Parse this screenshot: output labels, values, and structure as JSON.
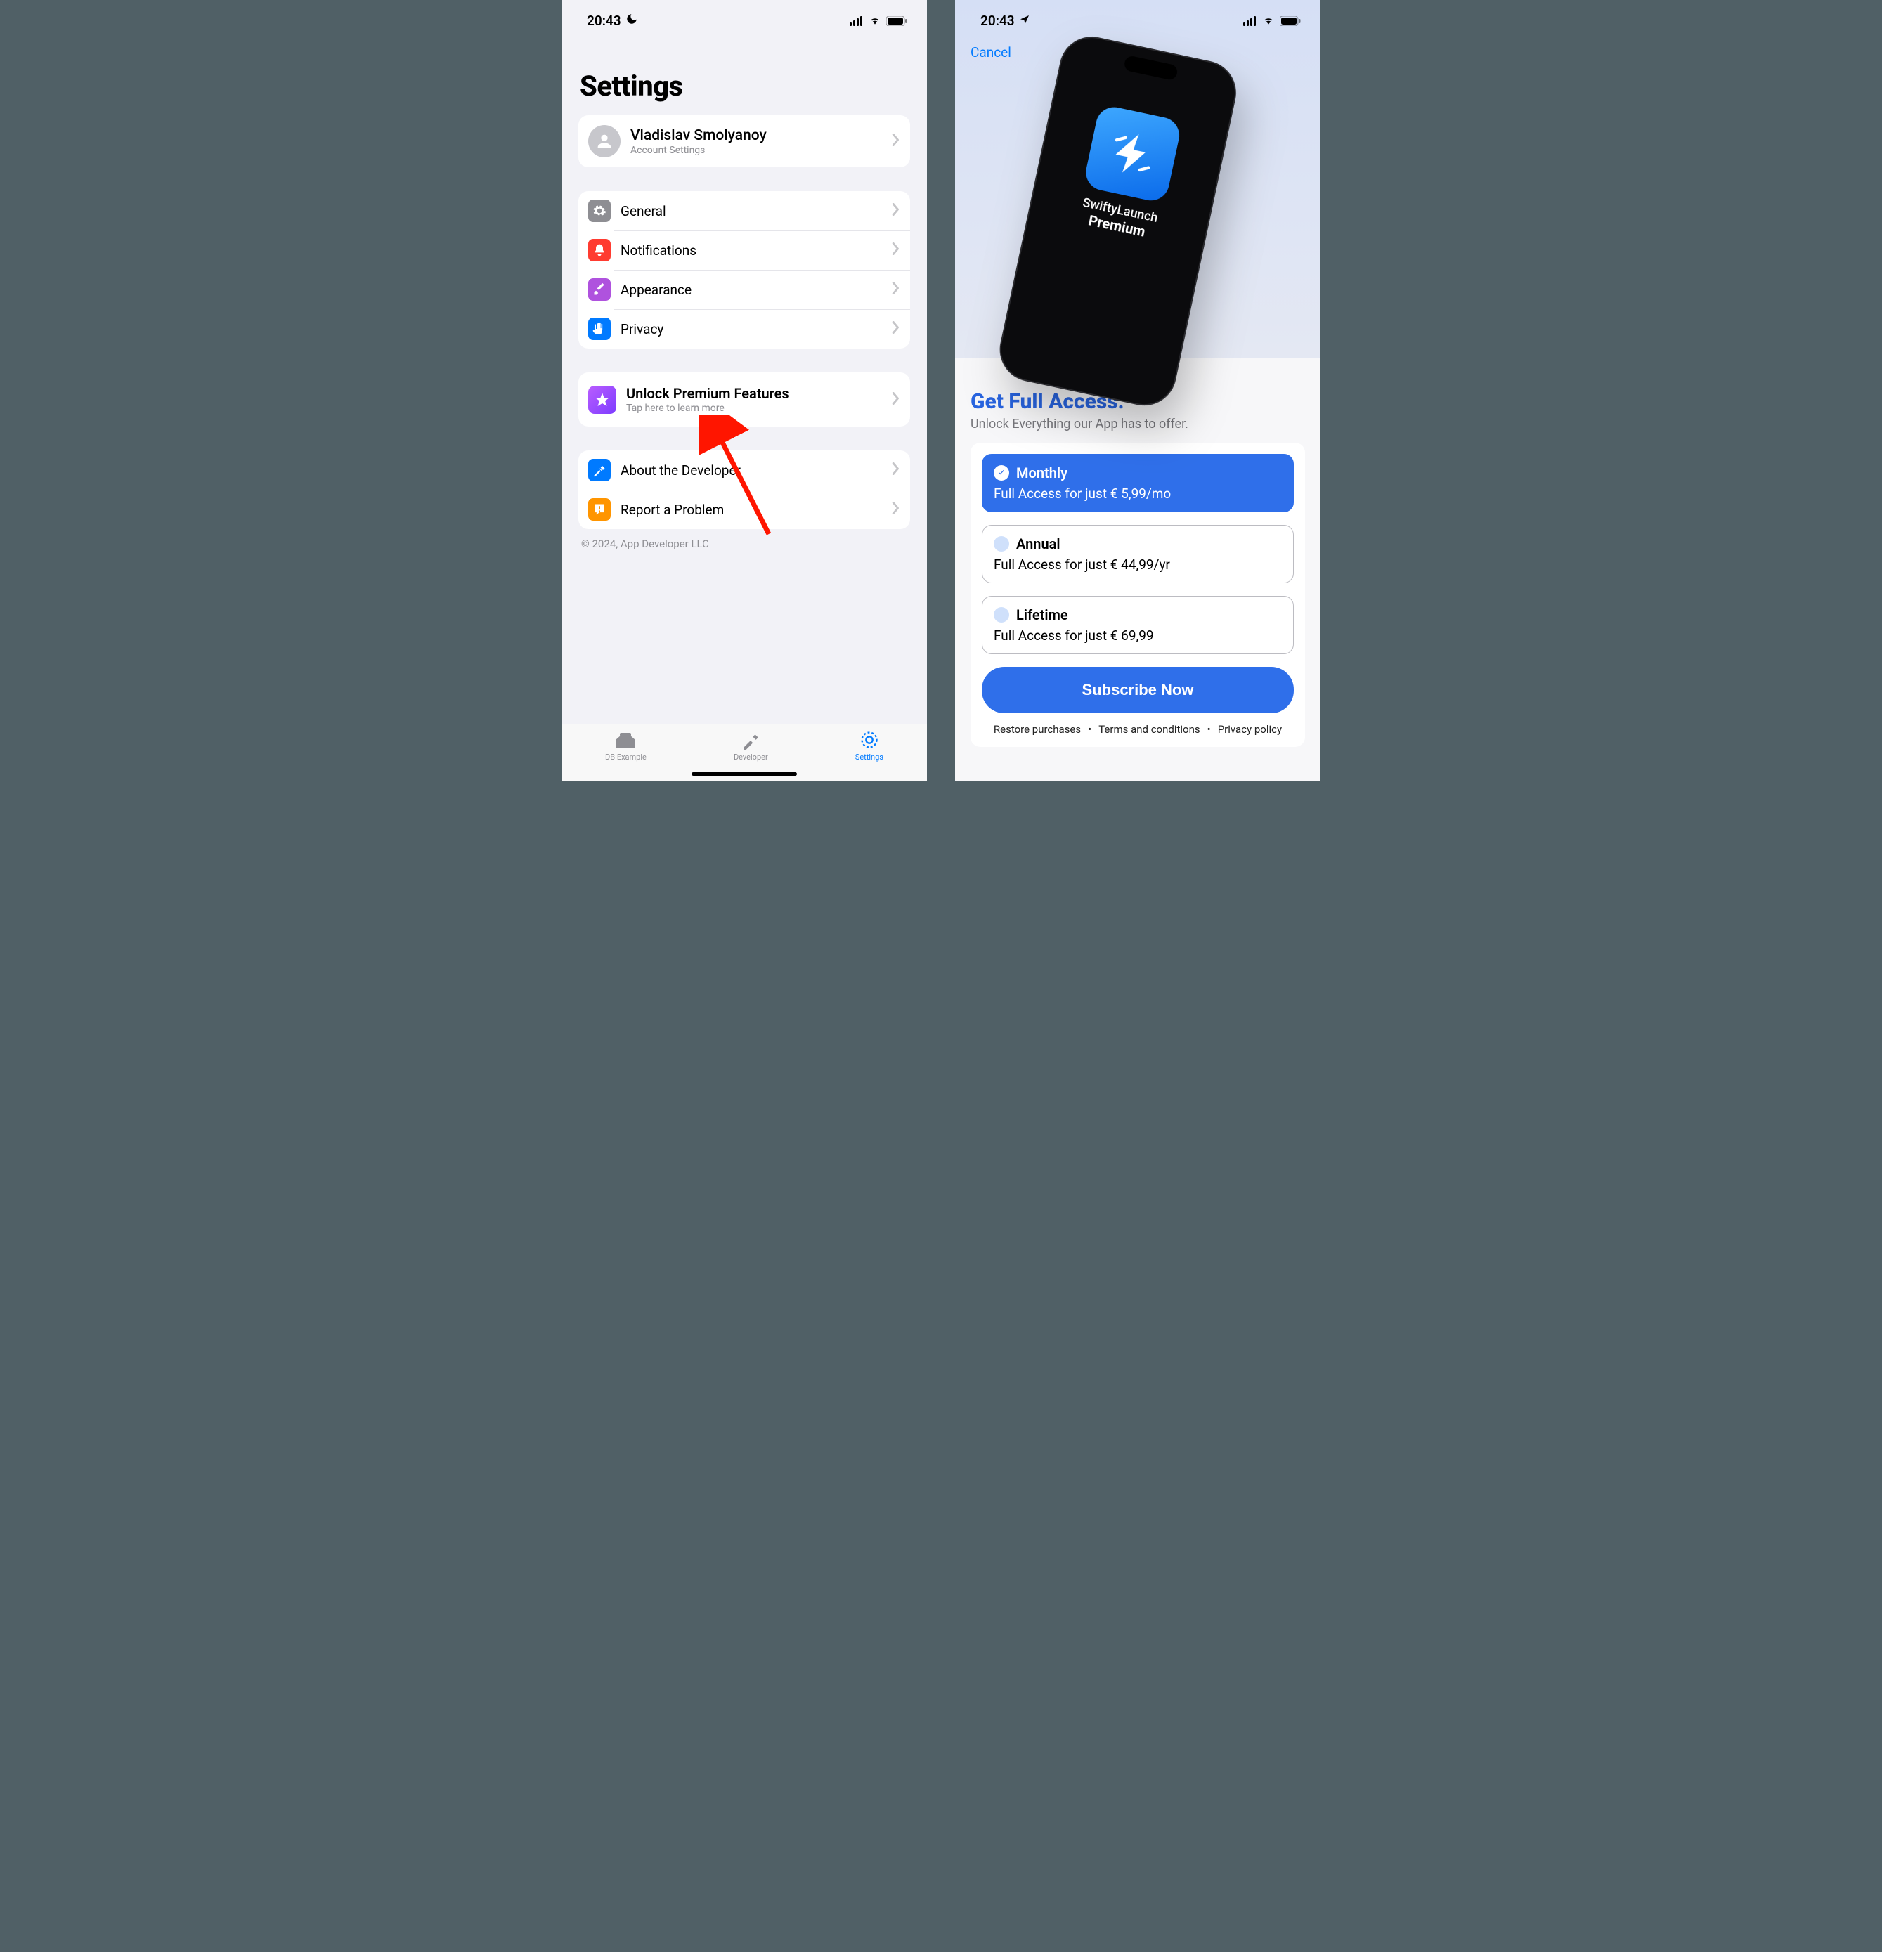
{
  "status": {
    "time": "20:43"
  },
  "settings": {
    "title": "Settings",
    "account": {
      "name": "Vladislav Smolyanoy",
      "sub": "Account Settings"
    },
    "group1": {
      "general": "General",
      "notifications": "Notifications",
      "appearance": "Appearance",
      "privacy": "Privacy"
    },
    "premium": {
      "title": "Unlock Premium Features",
      "sub": "Tap here to learn more"
    },
    "group2": {
      "about": "About the Developer",
      "report": "Report a Problem"
    },
    "footer": "© 2024, App Developer LLC",
    "tabs": {
      "db": "DB Example",
      "dev": "Developer",
      "settings": "Settings"
    }
  },
  "paywall": {
    "cancel": "Cancel",
    "mock": {
      "brand": "SwiftyLaunch",
      "premium": "Premium"
    },
    "title": "Get Full Access.",
    "sub": "Unlock Everything our App has to offer.",
    "plans": [
      {
        "name": "Monthly",
        "desc": "Full Access for just € 5,99/mo",
        "selected": true
      },
      {
        "name": "Annual",
        "desc": "Full Access for just € 44,99/yr",
        "selected": false
      },
      {
        "name": "Lifetime",
        "desc": "Full Access for just € 69,99",
        "selected": false
      }
    ],
    "cta": "Subscribe Now",
    "legal": {
      "restore": "Restore purchases",
      "terms": "Terms and conditions",
      "privacy": "Privacy policy"
    }
  }
}
